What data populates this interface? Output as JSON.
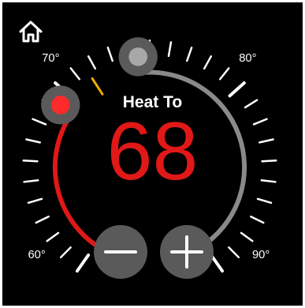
{
  "thermostat": {
    "mode_label": "Heat To",
    "setpoint": "68",
    "scale_labels": {
      "min": "60°",
      "low": "70°",
      "high": "80°",
      "max": "90°"
    }
  },
  "colors": {
    "heat": "#e01818",
    "indicator": "#f0b000",
    "track": "#8a8a8a",
    "button": "#5a5a5a"
  },
  "icons": {
    "home": "home-icon",
    "decrease": "minus-icon",
    "increase": "plus-icon"
  }
}
